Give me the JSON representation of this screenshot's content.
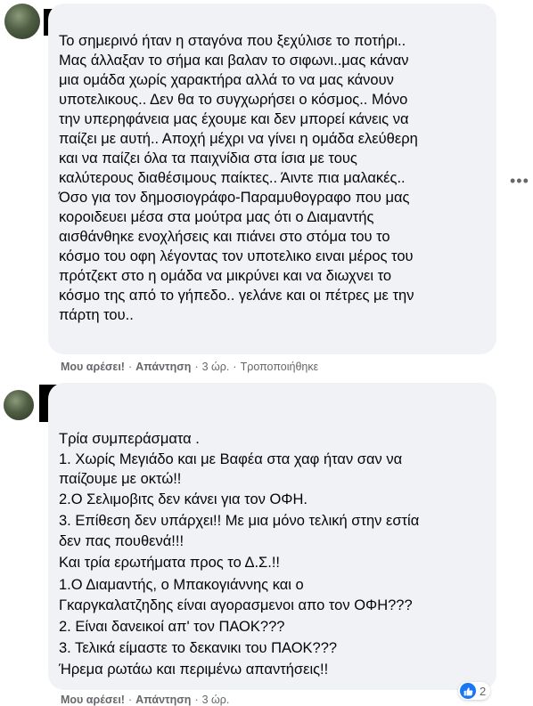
{
  "comments": [
    {
      "lines": [
        "Το σημερινό ήταν η σταγόνα που ξεχύλισε το ποτήρι..",
        "Μας άλλαξαν το σήμα και βαλαν το σιφωνι..μας κάναν",
        "μια ομάδα χωρίς χαρακτήρα αλλά το να μας κάνουν",
        "υποτελικους.. Δεν θα το συγχωρήσει ο κόσμος.. Μόνο",
        "την υπερηφάνεια μας έχουμε και δεν μπορεί κάνεις να",
        "παίζει με αυτή.. Αποχή μέχρι να γίνει η ομάδα ελεύθερη",
        "και να παίζει όλα τα παιχνίδια στα ίσια με τους",
        "καλύτερους διαθέσιμους παίκτες.. Άιντε πια μαλακές..",
        "Όσο για τον δημοσιογράφο-Παραμυθογραφο που μας",
        "κοροιδευει μέσα στα μούτρα μας ότι ο Διαμαντής",
        "αισθάνθηκε ενοχλήσεις και πιάνει στο στόμα του το",
        "κόσμο του οφη λέγοντας τον υποτελικο ειναι μέρος του",
        "πρότζεκτ στο η ομάδα να μικρύνει και να διωχνει το",
        "κόσμο της από το γήπεδο.. γελάνε και οι πέτρες με την",
        "πάρτη του.."
      ],
      "actions": {
        "like": "Μου αρέσει!",
        "reply": "Απάντηση",
        "time": "3 ώρ.",
        "edited": "Τροποποιήθηκε"
      }
    },
    {
      "lines": [
        "Τρία συμπεράσματα .",
        "1. Χωρίς Μεγιάδο και με Βαφέα στα χαφ ήταν σαν να",
        "παίζουμε με οκτώ!!",
        "2.Ο Σελιμοβιτς δεν κάνει για τον ΟΦΗ.",
        "3. Επίθεση δεν υπάρχει!! Με μια μόνο τελική στην εστία",
        "δεν πας πουθενά!!!",
        "Και τρία ερωτήματα προς το Δ.Σ.!!",
        "1.Ο Διαμαντής, ο Μπακογιάννης και ο",
        "Γκαργκαλατζηδης είναι αγορασμενοι απο τον ΟΦΗ???",
        "2. Είναι δανεικοί απ' τον ΠΑΟΚ???",
        "3. Τελικά είμαστε το δεκανικι του ΠΑΟΚ???",
        "Ήρεμα ρωτάω και περιμένω απαντήσεις!!"
      ],
      "actions": {
        "like": "Μου αρέσει!",
        "reply": "Απάντηση",
        "time": "3 ώρ."
      },
      "reactions": {
        "icon": "thumbs-up-icon",
        "count": "2",
        "color": "#1877f2"
      }
    }
  ],
  "more_options_icon": "more-horizontal-icon",
  "colors": {
    "bubble": "#f0f2f5",
    "meta_text": "#65676b",
    "text": "#050505"
  }
}
